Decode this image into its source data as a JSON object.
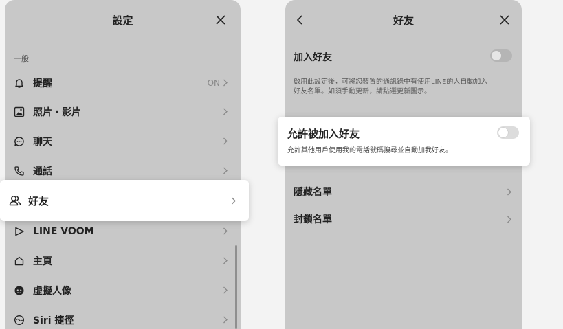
{
  "settings_panel": {
    "title": "設定",
    "section_label": "一般",
    "items": [
      {
        "label": "提醒",
        "icon": "bell-icon",
        "status": "ON"
      },
      {
        "label": "照片・影片",
        "icon": "photo-icon",
        "status": ""
      },
      {
        "label": "聊天",
        "icon": "chat-icon",
        "status": ""
      },
      {
        "label": "通話",
        "icon": "phone-icon",
        "status": ""
      },
      {
        "label": "好友",
        "icon": "friends-icon",
        "status": ""
      },
      {
        "label": "LINE VOOM",
        "icon": "voom-icon",
        "status": ""
      },
      {
        "label": "主頁",
        "icon": "home-icon",
        "status": ""
      },
      {
        "label": "虛擬人像",
        "icon": "avatar-icon",
        "status": ""
      },
      {
        "label": "Siri 捷徑",
        "icon": "siri-icon",
        "status": ""
      }
    ]
  },
  "friends_panel": {
    "title": "好友",
    "add_friends": {
      "title": "加入好友",
      "description_line1": "啟用此設定後，可將您裝置的通訊錄中有使用LINE的人自動加入",
      "description_line2": "好友名單。如須手動更新，請點選更新圖示。",
      "enabled": false
    },
    "allow_added": {
      "title": "允許被加入好友",
      "description": "允許其他用戶使用我的電話號碼搜尋並自動加我好友。",
      "enabled": false
    },
    "rows": [
      {
        "label": "隱藏名單"
      },
      {
        "label": "封鎖名單"
      }
    ]
  },
  "colors": {
    "panel_bg": "#c8c8c8",
    "card_bg": "#ffffff",
    "page_bg": "#f3f3f3"
  }
}
